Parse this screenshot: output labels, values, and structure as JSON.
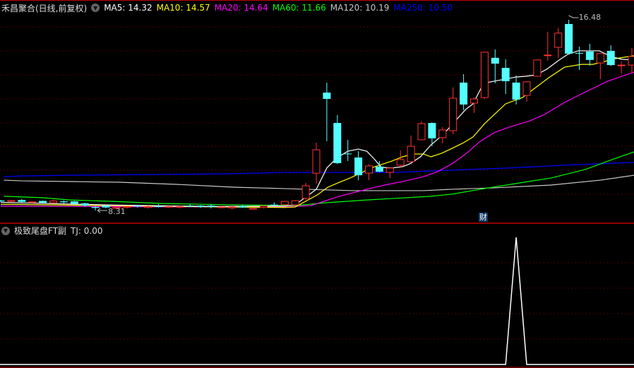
{
  "header": {
    "title": "禾昌聚合(日线,前复权)",
    "ma_labels": [
      {
        "text": "MA5: 14.32",
        "color": "#ffffff"
      },
      {
        "text": "MA10: 14.57",
        "color": "#ffff00"
      },
      {
        "text": "MA20: 14.64",
        "color": "#ff00ff"
      },
      {
        "text": "MA60: 11.66",
        "color": "#00ff00"
      },
      {
        "text": "MA120: 10.19",
        "color": "#c8c8c8"
      },
      {
        "text": "MA250: 10.50",
        "color": "#0000ff"
      }
    ]
  },
  "sub_header": {
    "title": "极致尾盘FT副",
    "value": "TJ: 0.00"
  },
  "marker": {
    "text": "财"
  },
  "colors": {
    "up": "#ff3232",
    "down": "#54ffff",
    "grid": "#8b0000",
    "separator": "#c00000"
  },
  "chart_data": [
    {
      "type": "candlestick",
      "title": "禾昌聚合(日线,前复权)",
      "ylim": [
        8.0,
        16.65
      ],
      "annotations": [
        {
          "text": "16.48",
          "index": 54,
          "value": 16.48
        },
        {
          "text": "8.31",
          "index": 9,
          "value": 8.31
        }
      ],
      "candles": [
        [
          8.74,
          8.76,
          8.68,
          8.7
        ],
        [
          8.7,
          8.76,
          8.68,
          8.74
        ],
        [
          8.76,
          8.8,
          8.66,
          8.68
        ],
        [
          8.66,
          8.7,
          8.62,
          8.68
        ],
        [
          8.72,
          8.74,
          8.62,
          8.64
        ],
        [
          8.64,
          8.78,
          8.62,
          8.72
        ],
        [
          8.7,
          8.74,
          8.62,
          8.66
        ],
        [
          8.7,
          8.72,
          8.56,
          8.6
        ],
        [
          8.62,
          8.64,
          8.48,
          8.52
        ],
        [
          8.46,
          8.5,
          8.31,
          8.42
        ],
        [
          8.52,
          8.54,
          8.4,
          8.44
        ],
        [
          8.4,
          8.46,
          8.38,
          8.44
        ],
        [
          8.44,
          8.5,
          8.4,
          8.48
        ],
        [
          8.52,
          8.54,
          8.44,
          8.48
        ],
        [
          8.44,
          8.52,
          8.4,
          8.48
        ],
        [
          8.5,
          8.58,
          8.44,
          8.46
        ],
        [
          8.46,
          8.5,
          8.42,
          8.48
        ],
        [
          8.46,
          8.52,
          8.4,
          8.48
        ],
        [
          8.52,
          8.58,
          8.46,
          8.48
        ],
        [
          8.52,
          8.54,
          8.42,
          8.46
        ],
        [
          8.52,
          8.58,
          8.4,
          8.46
        ],
        [
          8.44,
          8.48,
          8.4,
          8.46
        ],
        [
          8.42,
          8.52,
          8.36,
          8.46
        ],
        [
          8.5,
          8.56,
          8.42,
          8.44
        ],
        [
          8.38,
          8.42,
          8.36,
          8.4
        ],
        [
          8.44,
          8.54,
          8.4,
          8.5
        ],
        [
          8.56,
          8.66,
          8.5,
          8.52
        ],
        [
          8.56,
          8.72,
          8.54,
          8.7
        ],
        [
          8.55,
          8.76,
          8.53,
          8.73
        ],
        [
          8.83,
          9.49,
          8.76,
          9.37
        ],
        [
          9.91,
          11.22,
          9.46,
          10.91
        ],
        [
          13.36,
          13.79,
          11.28,
          13.09
        ],
        [
          12.06,
          12.4,
          10.3,
          10.34
        ],
        [
          10.75,
          11.34,
          10.43,
          10.73
        ],
        [
          10.58,
          10.85,
          9.61,
          9.82
        ],
        [
          9.91,
          10.28,
          9.61,
          10.22
        ],
        [
          10.19,
          10.43,
          9.95,
          9.97
        ],
        [
          9.94,
          10.15,
          9.7,
          10.13
        ],
        [
          10.25,
          10.88,
          10.13,
          10.49
        ],
        [
          10.4,
          11.52,
          10.38,
          11.06
        ],
        [
          11.34,
          12.12,
          11.32,
          12.03
        ],
        [
          12.06,
          12.08,
          11.06,
          11.4
        ],
        [
          11.43,
          11.88,
          11.19,
          11.76
        ],
        [
          11.73,
          13.58,
          11.58,
          13.12
        ],
        [
          13.79,
          14.15,
          12.61,
          12.85
        ],
        [
          12.91,
          13.15,
          12.49,
          13.09
        ],
        [
          13.15,
          15.12,
          13.1,
          15.09
        ],
        [
          14.85,
          15.21,
          13.76,
          14.6
        ],
        [
          14.42,
          14.79,
          13.3,
          13.85
        ],
        [
          13.79,
          14.09,
          12.85,
          13.06
        ],
        [
          13.24,
          13.85,
          12.97,
          13.82
        ],
        [
          14.06,
          14.78,
          14.04,
          14.76
        ],
        [
          14.96,
          15.97,
          14.73,
          14.97
        ],
        [
          15.3,
          16.12,
          14.85,
          15.91
        ],
        [
          16.3,
          16.48,
          15.0,
          15.03
        ],
        [
          15.06,
          15.33,
          14.33,
          15.05
        ],
        [
          15.12,
          15.45,
          14.51,
          14.76
        ],
        [
          14.63,
          15.05,
          13.94,
          15.03
        ],
        [
          15.15,
          15.39,
          14.5,
          14.54
        ],
        [
          14.51,
          14.7,
          14.18,
          14.54
        ],
        [
          14.54,
          15.27,
          14.18,
          14.91
        ]
      ],
      "series": [
        {
          "name": "MA5",
          "color": "#ffffff",
          "points": [
            [
              0,
              8.66
            ],
            [
              10,
              8.55
            ],
            [
              20,
              8.48
            ],
            [
              27,
              8.5
            ],
            [
              28,
              8.55
            ],
            [
              30,
              9.22
            ],
            [
              31,
              10.13
            ],
            [
              32,
              10.58
            ],
            [
              33,
              10.85
            ],
            [
              34,
              10.94
            ],
            [
              34.8,
              10.85
            ],
            [
              35.5,
              10.52
            ],
            [
              36.2,
              10.16
            ],
            [
              37.2,
              10.13
            ],
            [
              38.2,
              10.19
            ],
            [
              38.9,
              10.31
            ],
            [
              39.9,
              10.61
            ],
            [
              40.9,
              11.12
            ],
            [
              42.1,
              11.58
            ],
            [
              43.1,
              12.09
            ],
            [
              44.2,
              12.64
            ],
            [
              44.9,
              12.88
            ],
            [
              45.9,
              13.76
            ],
            [
              46.9,
              13.85
            ],
            [
              48,
              13.94
            ],
            [
              49,
              14.03
            ],
            [
              49.9,
              14.06
            ],
            [
              50.9,
              14.12
            ],
            [
              51.9,
              14.36
            ],
            [
              53,
              14.73
            ],
            [
              53.9,
              15.0
            ],
            [
              54.9,
              15.15
            ],
            [
              56.9,
              15.15
            ],
            [
              58,
              14.91
            ],
            [
              59,
              14.79
            ],
            [
              60,
              14.76
            ]
          ]
        },
        {
          "name": "MA10",
          "color": "#ffff00",
          "points": [
            [
              0,
              8.58
            ],
            [
              10,
              8.52
            ],
            [
              20,
              8.47
            ],
            [
              27,
              8.44
            ],
            [
              28,
              8.46
            ],
            [
              30.1,
              8.98
            ],
            [
              31.1,
              9.31
            ],
            [
              32.2,
              9.52
            ],
            [
              33.2,
              9.7
            ],
            [
              34.2,
              9.91
            ],
            [
              35.2,
              10.13
            ],
            [
              36.2,
              10.28
            ],
            [
              37.2,
              10.43
            ],
            [
              38.2,
              10.61
            ],
            [
              39.2,
              10.73
            ],
            [
              40.2,
              10.73
            ],
            [
              40.9,
              10.61
            ],
            [
              41.9,
              10.76
            ],
            [
              42.9,
              10.97
            ],
            [
              43.9,
              11.19
            ],
            [
              44.9,
              11.46
            ],
            [
              46,
              12.03
            ],
            [
              48,
              12.88
            ],
            [
              49.6,
              13.15
            ],
            [
              52.1,
              14.0
            ],
            [
              53.6,
              14.45
            ],
            [
              55.2,
              14.57
            ],
            [
              56.3,
              14.57
            ],
            [
              58.5,
              14.82
            ],
            [
              60.2,
              14.94
            ]
          ]
        },
        {
          "name": "MA20",
          "color": "#ff00ff",
          "points": [
            [
              0,
              8.5
            ],
            [
              15,
              8.47
            ],
            [
              27,
              8.46
            ],
            [
              29.5,
              8.52
            ],
            [
              31.1,
              8.76
            ],
            [
              32.2,
              8.92
            ],
            [
              33.5,
              9.07
            ],
            [
              34.8,
              9.22
            ],
            [
              36.5,
              9.4
            ],
            [
              38.2,
              9.55
            ],
            [
              40.2,
              9.76
            ],
            [
              41.5,
              9.97
            ],
            [
              42.9,
              10.31
            ],
            [
              44.2,
              10.73
            ],
            [
              45.6,
              11.28
            ],
            [
              46.9,
              11.64
            ],
            [
              48.3,
              11.88
            ],
            [
              50.3,
              12.15
            ],
            [
              51.6,
              12.4
            ],
            [
              53.6,
              12.94
            ],
            [
              55.6,
              13.39
            ],
            [
              57.7,
              13.85
            ],
            [
              60.2,
              14.24
            ]
          ]
        },
        {
          "name": "MA60",
          "color": "#00ff00",
          "points": [
            [
              0.3,
              8.92
            ],
            [
              4,
              8.86
            ],
            [
              6.6,
              8.76
            ],
            [
              10.7,
              8.7
            ],
            [
              15.4,
              8.61
            ],
            [
              22.1,
              8.55
            ],
            [
              28.1,
              8.52
            ],
            [
              30.8,
              8.64
            ],
            [
              34.8,
              8.76
            ],
            [
              37.5,
              8.83
            ],
            [
              40.9,
              8.92
            ],
            [
              42.9,
              9.01
            ],
            [
              45.6,
              9.22
            ],
            [
              48.9,
              9.46
            ],
            [
              52.3,
              9.7
            ],
            [
              55.6,
              10.07
            ],
            [
              58.3,
              10.52
            ],
            [
              60.2,
              10.82
            ]
          ]
        },
        {
          "name": "MA120",
          "color": "#c8c8c8",
          "points": [
            [
              0.3,
              9.61
            ],
            [
              2,
              9.58
            ],
            [
              6.6,
              9.55
            ],
            [
              11.3,
              9.52
            ],
            [
              16.7,
              9.43
            ],
            [
              22.1,
              9.31
            ],
            [
              26.8,
              9.25
            ],
            [
              33.5,
              9.16
            ],
            [
              40.2,
              9.16
            ],
            [
              42.9,
              9.22
            ],
            [
              46.9,
              9.28
            ],
            [
              52.3,
              9.4
            ],
            [
              57,
              9.61
            ],
            [
              60.2,
              9.82
            ]
          ]
        },
        {
          "name": "MA250",
          "color": "#0000ff",
          "points": [
            [
              0.3,
              9.76
            ],
            [
              2,
              9.79
            ],
            [
              6.6,
              9.82
            ],
            [
              21.4,
              9.88
            ],
            [
              26.8,
              9.94
            ],
            [
              37.5,
              9.94
            ],
            [
              42.9,
              10.04
            ],
            [
              48.3,
              10.13
            ],
            [
              53.6,
              10.25
            ],
            [
              60.2,
              10.37
            ]
          ]
        }
      ]
    },
    {
      "type": "line",
      "title": "极致尾盘FT副",
      "ylim": [
        0,
        1
      ],
      "series": [
        {
          "name": "TJ",
          "color": "#ffffff",
          "values": [
            0,
            0,
            0,
            0,
            0,
            0,
            0,
            0,
            0,
            0,
            0,
            0,
            0,
            0,
            0,
            0,
            0,
            0,
            0,
            0,
            0,
            0,
            0,
            0,
            0,
            0,
            0,
            0,
            0,
            0,
            0,
            0,
            0,
            0,
            0,
            0,
            0,
            0,
            0,
            0,
            0,
            0,
            0,
            0,
            0,
            0,
            0,
            0,
            0,
            1,
            0,
            0,
            0,
            0,
            0,
            0,
            0,
            0,
            0,
            0,
            0
          ]
        }
      ]
    }
  ]
}
